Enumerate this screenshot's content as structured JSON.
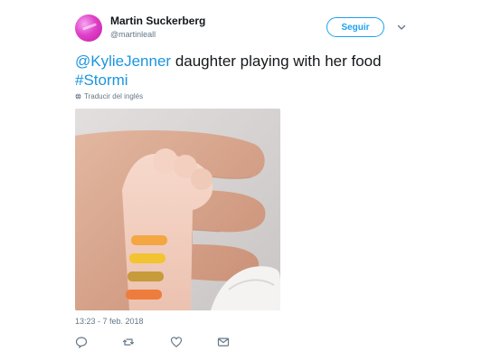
{
  "user": {
    "name": "Martin Suckerberg",
    "handle": "@martinleall"
  },
  "follow_label": "Seguir",
  "tweet": {
    "mention": "@KylieJenner",
    "text": " daughter playing with her food",
    "hashtag": "#Stormi"
  },
  "translate_label": "Traducir del inglés",
  "timestamp": "13:23 - 7 feb. 2018",
  "icons": {
    "caret": "chevron-down-icon",
    "translate": "globe-icon",
    "reply": "reply-icon",
    "retweet": "retweet-icon",
    "like": "heart-icon",
    "dm": "envelope-icon"
  },
  "colors": {
    "link": "#1b95e0",
    "follow_border": "#1da1f2",
    "muted": "#657786",
    "text": "#14171a"
  }
}
